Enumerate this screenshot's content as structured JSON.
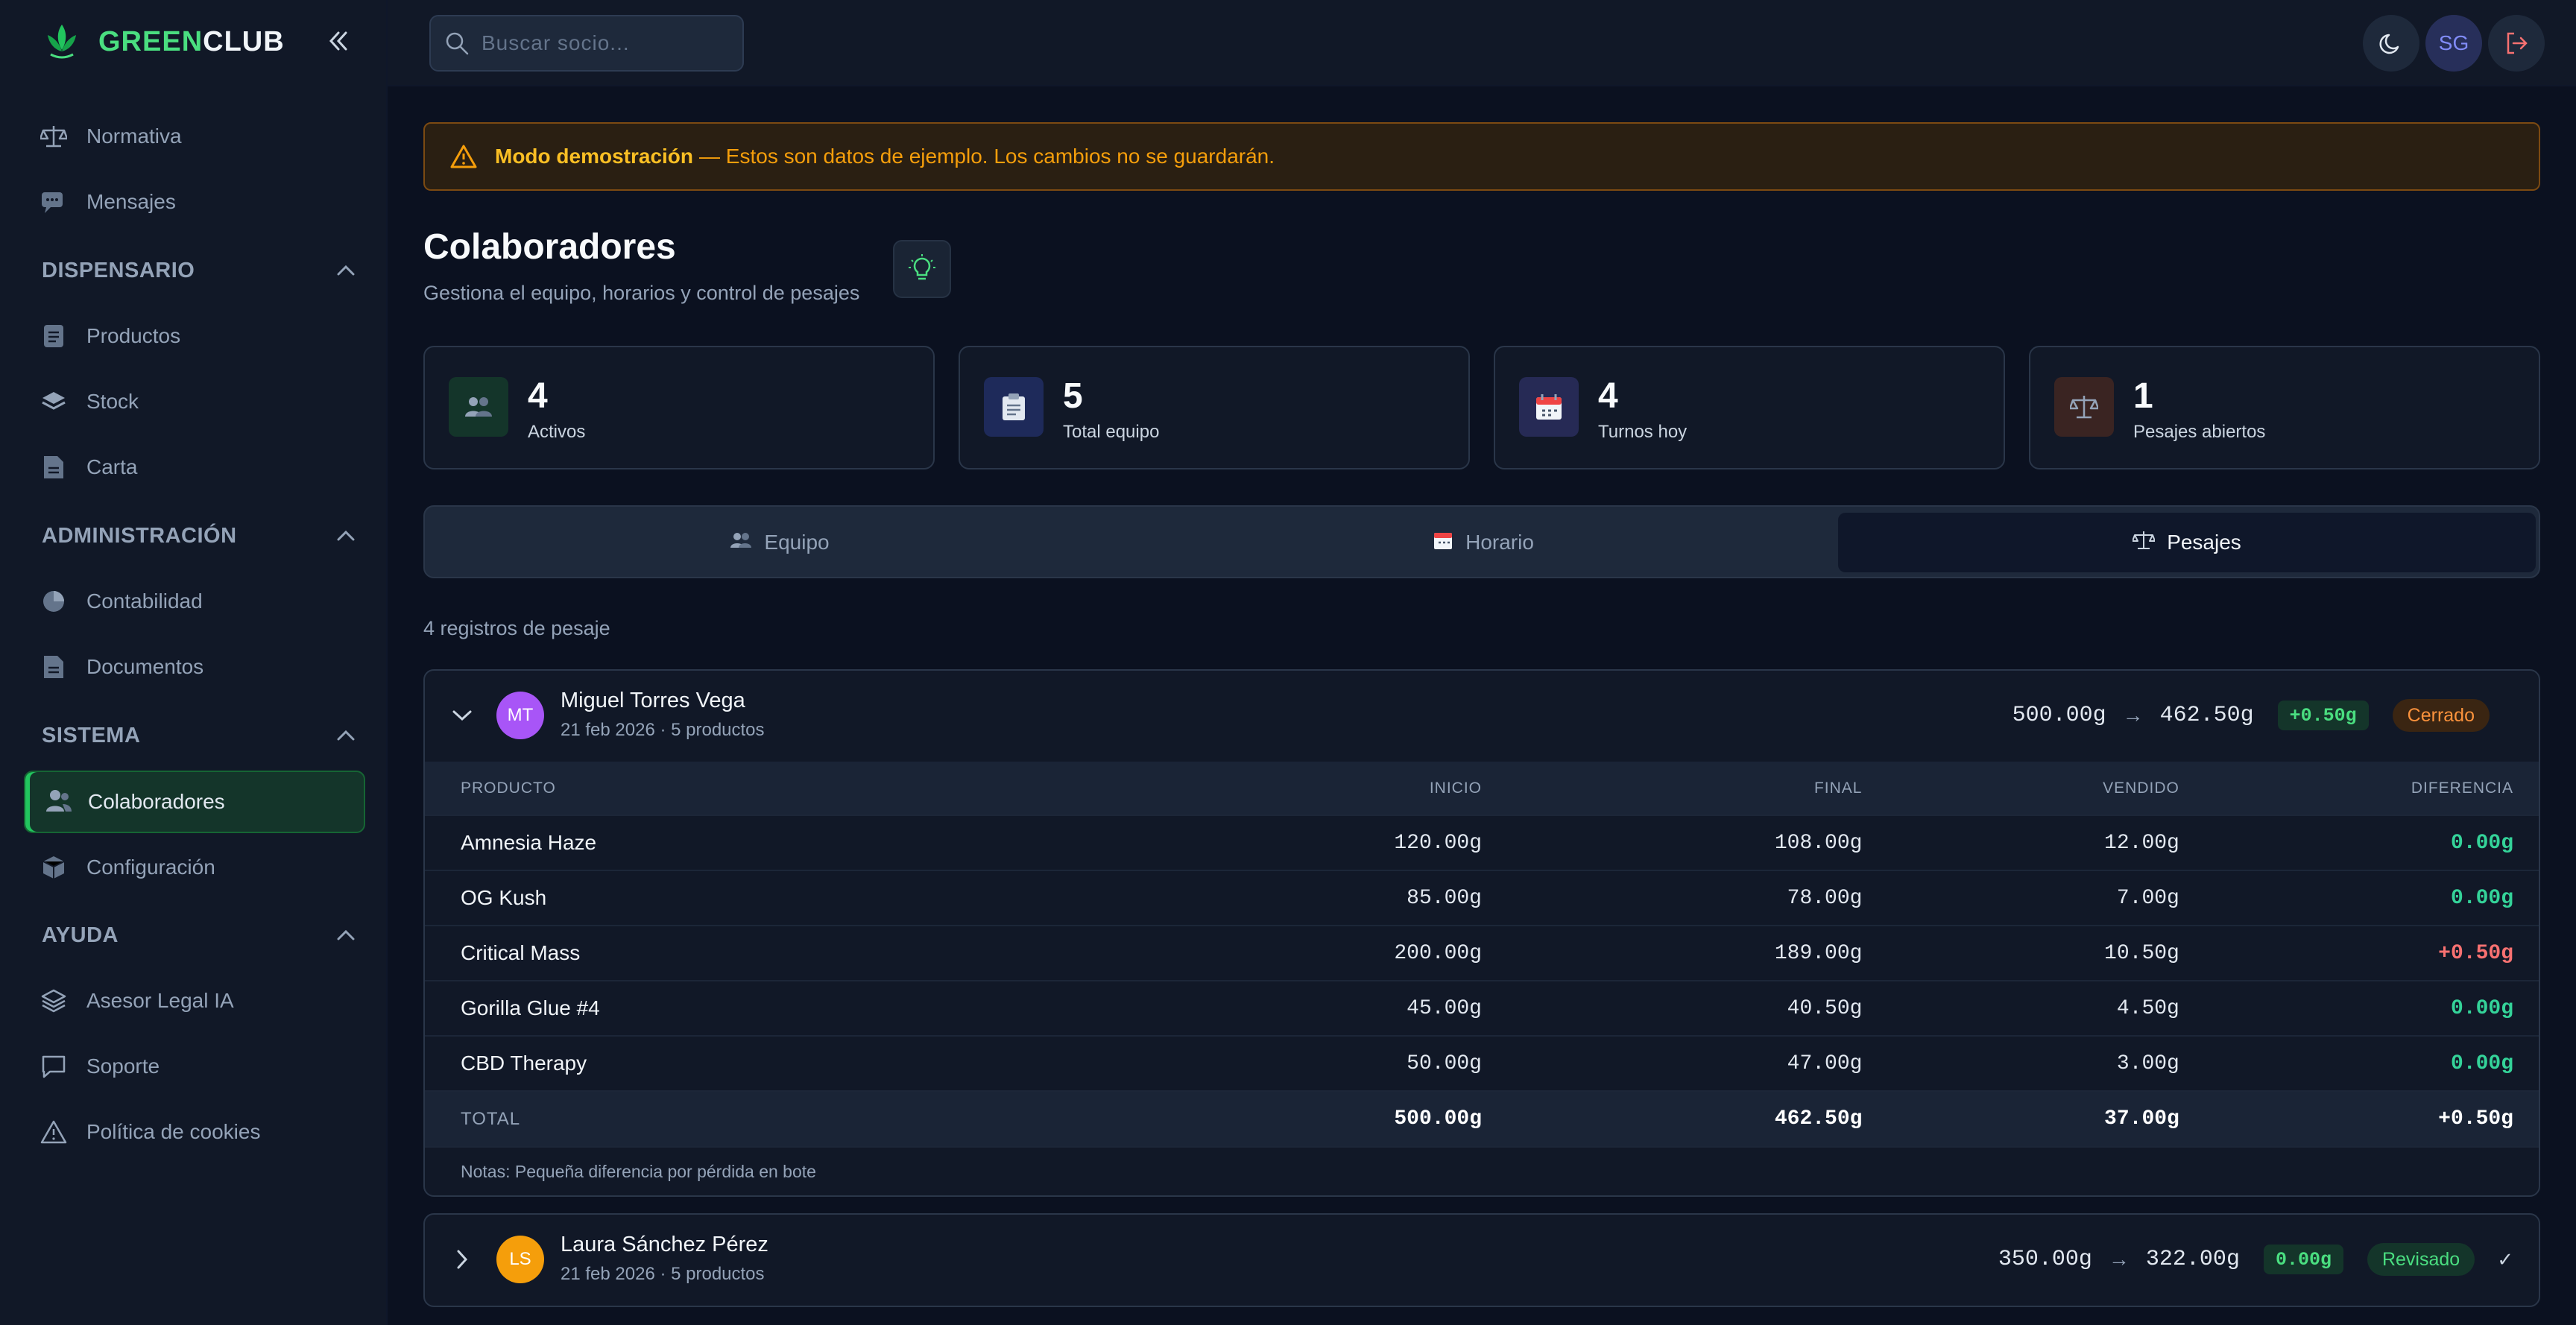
{
  "brand": {
    "part1": "GREEN",
    "part2": "CLUB"
  },
  "sidebar": {
    "top_items": [
      {
        "label": "Normativa",
        "icon": "scale-icon"
      },
      {
        "label": "Mensajes",
        "icon": "chat-icon"
      }
    ],
    "sections": [
      {
        "title": "DISPENSARIO",
        "items": [
          {
            "label": "Productos",
            "icon": "file-icon"
          },
          {
            "label": "Stock",
            "icon": "layers-icon"
          },
          {
            "label": "Carta",
            "icon": "file-icon"
          }
        ]
      },
      {
        "title": "ADMINISTRACIÓN",
        "items": [
          {
            "label": "Contabilidad",
            "icon": "pie-chart-icon"
          },
          {
            "label": "Documentos",
            "icon": "file-icon"
          }
        ]
      },
      {
        "title": "SISTEMA",
        "items": [
          {
            "label": "Colaboradores",
            "icon": "users-icon"
          },
          {
            "label": "Configuración",
            "icon": "cube-icon"
          }
        ]
      },
      {
        "title": "AYUDA",
        "items": [
          {
            "label": "Asesor Legal IA",
            "icon": "layers-icon"
          },
          {
            "label": "Soporte",
            "icon": "message-square-icon"
          },
          {
            "label": "Política de cookies",
            "icon": "warning-icon"
          }
        ]
      }
    ]
  },
  "topbar": {
    "search_placeholder": "Buscar socio...",
    "user_initials": "SG"
  },
  "alert": {
    "strong": "Modo demostración",
    "rest": "— Estos son datos de ejemplo. Los cambios no se guardarán."
  },
  "page": {
    "title": "Colaboradores",
    "subtitle": "Gestiona el equipo, horarios y control de pesajes"
  },
  "stats": [
    {
      "value": "4",
      "label": "Activos"
    },
    {
      "value": "5",
      "label": "Total equipo"
    },
    {
      "value": "4",
      "label": "Turnos hoy"
    },
    {
      "value": "1",
      "label": "Pesajes abiertos"
    }
  ],
  "tabs": [
    {
      "label": "Equipo"
    },
    {
      "label": "Horario"
    },
    {
      "label": "Pesajes"
    }
  ],
  "records_count": "4 registros de pesaje",
  "records": [
    {
      "initials": "MT",
      "name": "Miguel Torres Vega",
      "meta": "21 feb 2026 · 5 productos",
      "start": "500.00g",
      "end": "462.50g",
      "diff": "+0.50g",
      "status": "Cerrado",
      "columns": [
        "PRODUCTO",
        "INICIO",
        "FINAL",
        "VENDIDO",
        "DIFERENCIA"
      ],
      "rows": [
        {
          "product": "Amnesia Haze",
          "start": "120.00g",
          "end": "108.00g",
          "sold": "12.00g",
          "diff": "0.00g"
        },
        {
          "product": "OG Kush",
          "start": "85.00g",
          "end": "78.00g",
          "sold": "7.00g",
          "diff": "0.00g"
        },
        {
          "product": "Critical Mass",
          "start": "200.00g",
          "end": "189.00g",
          "sold": "10.50g",
          "diff": "+0.50g"
        },
        {
          "product": "Gorilla Glue #4",
          "start": "45.00g",
          "end": "40.50g",
          "sold": "4.50g",
          "diff": "0.00g"
        },
        {
          "product": "CBD Therapy",
          "start": "50.00g",
          "end": "47.00g",
          "sold": "3.00g",
          "diff": "0.00g"
        }
      ],
      "total": {
        "label": "TOTAL",
        "start": "500.00g",
        "end": "462.50g",
        "sold": "37.00g",
        "diff": "+0.50g"
      },
      "notes": "Notas: Pequeña diferencia por pérdida en bote"
    },
    {
      "initials": "LS",
      "name": "Laura Sánchez Pérez",
      "meta": "21 feb 2026 · 5 productos",
      "start": "350.00g",
      "end": "322.00g",
      "diff": "0.00g",
      "status": "Revisado",
      "check": "✓"
    }
  ],
  "colors": {
    "accent": "#22c55e",
    "warning": "#f59e0b",
    "danger": "#f87171"
  }
}
